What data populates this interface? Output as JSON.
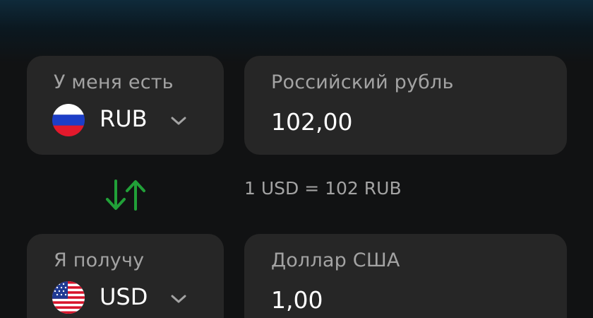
{
  "from": {
    "label": "У меня есть",
    "currency_code": "RUB",
    "currency_name": "Российский рубль",
    "amount": "102,00",
    "flag_icon": "russia-flag-icon"
  },
  "to": {
    "label": "Я получу",
    "currency_code": "USD",
    "currency_name": "Доллар США",
    "amount": "1,00",
    "flag_icon": "usa-flag-icon"
  },
  "exchange": {
    "rate_text": "1 USD = 102 RUB",
    "swap_icon": "swap-arrows-icon"
  },
  "colors": {
    "background": "#111213",
    "card": "#262626",
    "label": "#a3a3a3",
    "accent_green": "#21a038",
    "text": "#ffffff"
  }
}
